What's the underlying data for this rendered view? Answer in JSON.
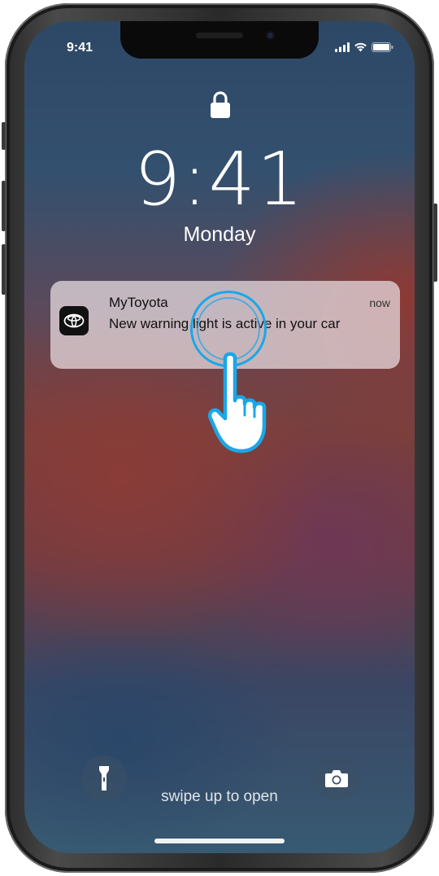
{
  "status_bar": {
    "time": "9:41",
    "icons": [
      "cellular-signal-icon",
      "wifi-icon",
      "battery-icon"
    ]
  },
  "lock_screen": {
    "lock_icon": "lock-icon",
    "time": "9:41",
    "day": "Monday"
  },
  "notification": {
    "app_name": "MyToyota",
    "timestamp": "now",
    "message": "New warning light is active in your car",
    "app_icon": "toyota-logo-icon"
  },
  "gesture_hint": {
    "icon": "tap-hand-icon",
    "ring_color": "#1aa7e8"
  },
  "bottom_controls": {
    "flashlight_icon": "flashlight-icon",
    "camera_icon": "camera-icon",
    "swipe_label": "swipe up to open"
  },
  "colors": {
    "accent": "#1aa7e8",
    "notification_bg": "#ebe1e4"
  }
}
